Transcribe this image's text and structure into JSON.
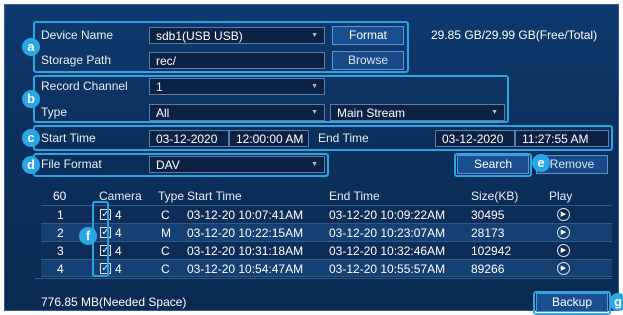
{
  "device": {
    "name_label": "Device Name",
    "name_value": "sdb1(USB USB)",
    "format_button": "Format",
    "capacity": "29.85 GB/29.99 GB(Free/Total)",
    "path_label": "Storage Path",
    "path_value": "rec/",
    "browse_button": "Browse"
  },
  "record": {
    "channel_label": "Record Channel",
    "channel_value": "1",
    "type_label": "Type",
    "type_value": "All",
    "stream_value": "Main Stream"
  },
  "time": {
    "start_label": "Start Time",
    "start_date": "03-12-2020",
    "start_time": "12:00:00 AM",
    "end_label": "End Time",
    "end_date": "03-12-2020",
    "end_time": "11:27:55 AM"
  },
  "file_format": {
    "label": "File Format",
    "value": "DAV",
    "search_button": "Search",
    "remove_button": "Remove"
  },
  "table": {
    "headers": {
      "count": "60",
      "camera": "Camera",
      "type": "Type",
      "start": "Start Time",
      "end": "End Time",
      "size": "Size(KB)",
      "play": "Play"
    },
    "rows": [
      {
        "num": "1",
        "camera": "4",
        "type": "C",
        "start": "03-12-20 10:07:41AM",
        "end": "03-12-20 10:09:22AM",
        "size": "30495",
        "checked": "✓"
      },
      {
        "num": "2",
        "camera": "4",
        "type": "M",
        "start": "03-12-20 10:22:15AM",
        "end": "03-12-20 10:23:07AM",
        "size": "28173",
        "checked": "✓"
      },
      {
        "num": "3",
        "camera": "4",
        "type": "C",
        "start": "03-12-20 10:31:18AM",
        "end": "03-12-20 10:32:46AM",
        "size": "102942",
        "checked": "✓"
      },
      {
        "num": "4",
        "camera": "4",
        "type": "C",
        "start": "03-12-20 10:54:47AM",
        "end": "03-12-20 10:55:57AM",
        "size": "89266",
        "checked": "✓"
      }
    ]
  },
  "footer": {
    "needed_space": "776.85 MB(Needed Space)",
    "backup_button": "Backup"
  },
  "callouts": {
    "a": "a",
    "b": "b",
    "c": "c",
    "d": "d",
    "e": "e",
    "f": "f",
    "g": "g"
  },
  "icons": {
    "dropdown": "chevron-down-icon",
    "play": "play-circle-icon",
    "check": "checkbox-icon"
  },
  "colors": {
    "panel": "#0b2f5c",
    "callout": "#29a6e6",
    "button": "#1a4f8f"
  }
}
